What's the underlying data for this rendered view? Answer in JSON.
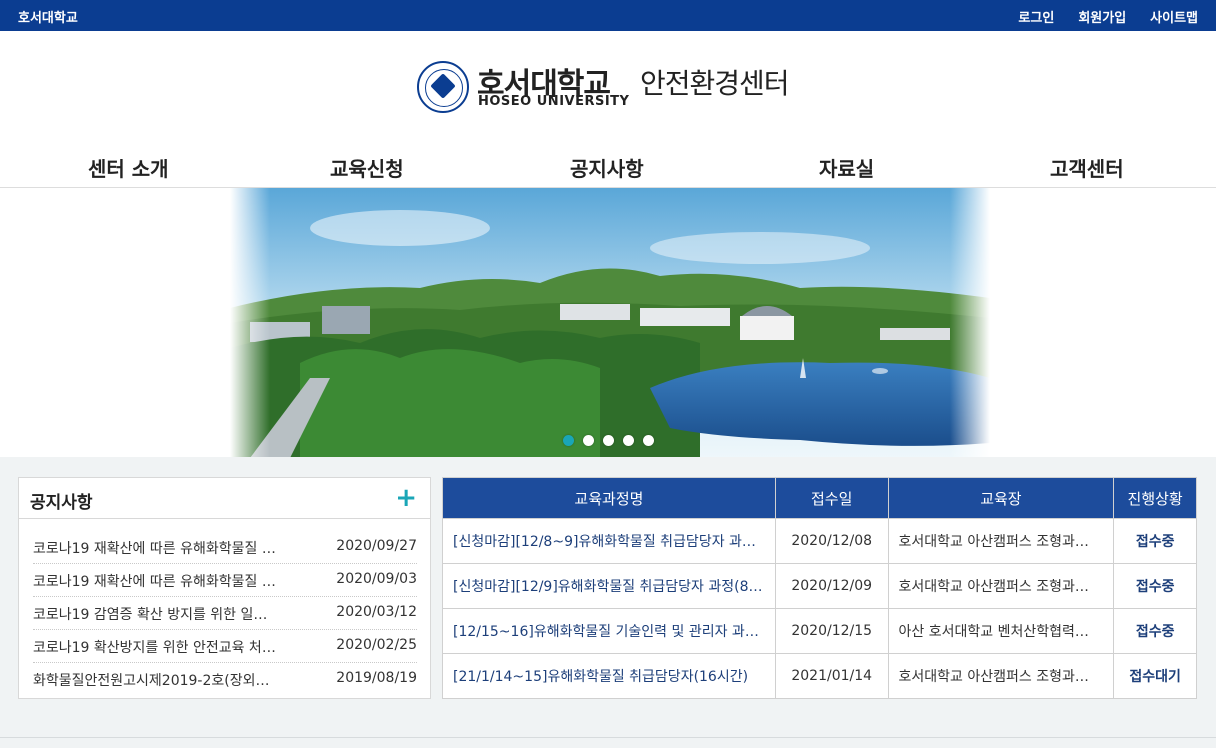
{
  "topbar": {
    "brand": "호서대학교",
    "links": [
      "로그인",
      "회원가입",
      "사이트맵"
    ]
  },
  "logo": {
    "korean": "호서대학교",
    "english": "HOSEO UNIVERSITY",
    "center": "안전환경센터"
  },
  "gnb": [
    "센터 소개",
    "교육신청",
    "공지사항",
    "자료실",
    "고객센터"
  ],
  "slider": {
    "dot_count": 5,
    "active_index": 0
  },
  "notice": {
    "title": "공지사항",
    "plus": "+",
    "items": [
      {
        "title": "코로나19 재확산에 따른 유해화학물질 …",
        "date": "2020/09/27"
      },
      {
        "title": "코로나19 재확산에 따른 유해화학물질 …",
        "date": "2020/09/03"
      },
      {
        "title": "코로나19 감염증 확산 방지를 위한 일…",
        "date": "2020/03/12"
      },
      {
        "title": "코로나19 확산방지를 위한 안전교육 처…",
        "date": "2020/02/25"
      },
      {
        "title": "화학물질안전원고시제2019-2호(장외…",
        "date": "2019/08/19"
      }
    ]
  },
  "courses": {
    "headers": [
      "교육과정명",
      "접수일",
      "교육장",
      "진행상황"
    ],
    "rows": [
      {
        "name": "[신청마감][12/8~9]유해화학물질 취급담당자 과…",
        "date": "2020/12/08",
        "place": "호서대학교 아산캠퍼스 조형과…",
        "status": "접수중"
      },
      {
        "name": "[신청마감][12/9]유해화학물질 취급담당자 과정(8…",
        "date": "2020/12/09",
        "place": "호서대학교 아산캠퍼스 조형과…",
        "status": "접수중"
      },
      {
        "name": "[12/15~16]유해화학물질 기술인력 및 관리자 과…",
        "date": "2020/12/15",
        "place": "아산 호서대학교 벤처산학협력…",
        "status": "접수중"
      },
      {
        "name": "[21/1/14~15]유해화학물질 취급담당자(16시간)",
        "date": "2021/01/14",
        "place": "호서대학교 아산캠퍼스 조형과…",
        "status": "접수대기"
      }
    ]
  },
  "colors": {
    "topbar": "#0b3d91",
    "table_header": "#1d4c9c",
    "accent": "#1aa6b7"
  }
}
